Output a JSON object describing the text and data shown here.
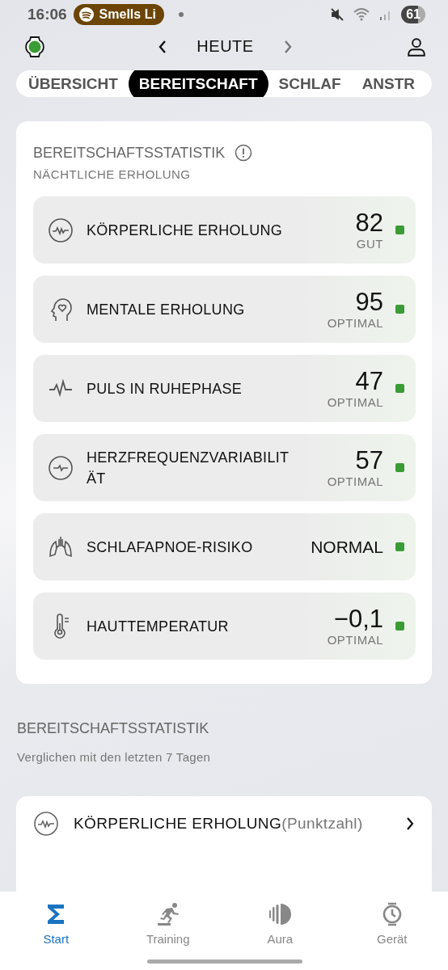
{
  "status_bar": {
    "time": "16:06",
    "media": "Smells Li",
    "battery": "61"
  },
  "header": {
    "title": "HEUTE"
  },
  "tabs": [
    {
      "label": "ÜBERSICHT",
      "selected": false
    },
    {
      "label": "BEREITSCHAFT",
      "selected": true
    },
    {
      "label": "SCHLAF",
      "selected": false
    },
    {
      "label": "ANSTR",
      "selected": false
    }
  ],
  "stats_card": {
    "title": "BEREITSCHAFTSSTATISTIK",
    "subtitle": "NÄCHTLICHE ERHOLUNG",
    "metrics": [
      {
        "kind": "score",
        "name": "KÖRPERLICHE ERHOLUNG",
        "value": "82",
        "rating": "GUT"
      },
      {
        "kind": "score",
        "name": "MENTALE ERHOLUNG",
        "value": "95",
        "rating": "OPTIMAL"
      },
      {
        "kind": "score",
        "name": "PULS IN RUHEPHASE",
        "value": "47",
        "rating": "OPTIMAL"
      },
      {
        "kind": "score",
        "name": "HERZFREQUENZVARIABILITÄT",
        "value": "57",
        "rating": "OPTIMAL"
      },
      {
        "kind": "text",
        "name": "SCHLAFAPNOE-RISIKO",
        "value": "NORMAL"
      },
      {
        "kind": "score",
        "name": "HAUTTEMPERATUR",
        "value": "−0,1",
        "rating": "OPTIMAL"
      }
    ]
  },
  "comparison": {
    "title": "BEREITSCHAFTSSTATISTIK",
    "subtitle": "Verglichen mit den letzten 7 Tagen",
    "rows": [
      {
        "name": "KÖRPERLICHE ERHOLUNG",
        "unit": "(Punktzahl)"
      }
    ]
  },
  "bottom_nav": [
    {
      "label": "Start",
      "selected": true
    },
    {
      "label": "Training",
      "selected": false
    },
    {
      "label": "Aura",
      "selected": false
    },
    {
      "label": "Gerät",
      "selected": false
    }
  ]
}
